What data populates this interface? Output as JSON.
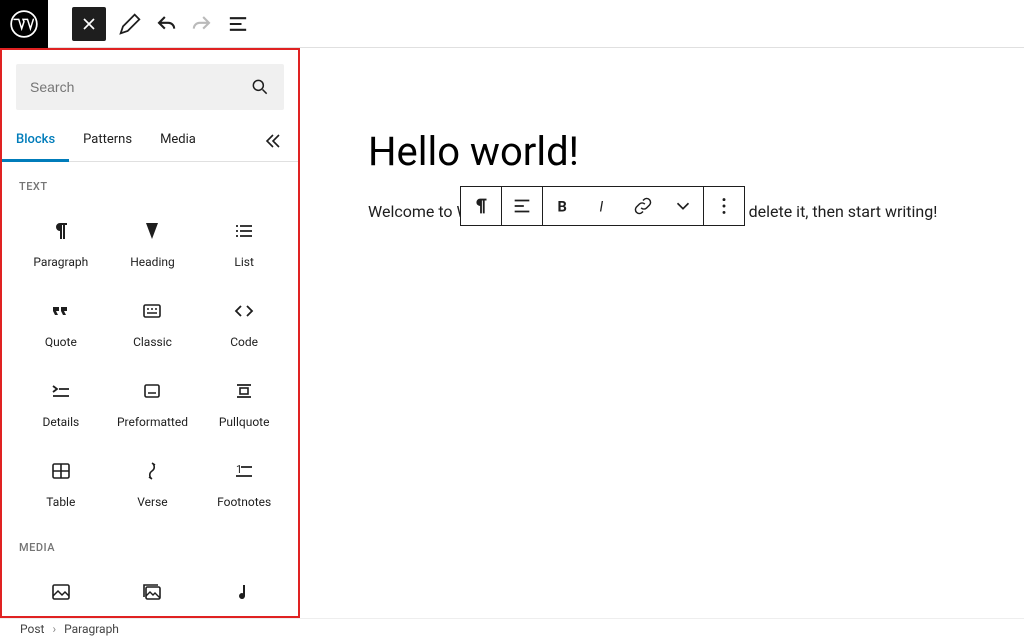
{
  "topbar": {
    "close_tooltip": "Close",
    "edit_tooltip": "Tools",
    "undo_tooltip": "Undo",
    "redo_tooltip": "Redo",
    "outline_tooltip": "Document Overview"
  },
  "inserter": {
    "search_placeholder": "Search",
    "tabs": {
      "blocks": "Blocks",
      "patterns": "Patterns",
      "media": "Media"
    },
    "section_text": "TEXT",
    "section_media": "MEDIA",
    "text_blocks": {
      "paragraph": "Paragraph",
      "heading": "Heading",
      "list": "List",
      "quote": "Quote",
      "classic": "Classic",
      "code": "Code",
      "details": "Details",
      "preformatted": "Preformatted",
      "pullquote": "Pullquote",
      "table": "Table",
      "verse": "Verse",
      "footnotes": "Footnotes"
    },
    "media_blocks": {
      "image": "Image",
      "gallery": "Gallery",
      "audio": "Audio"
    }
  },
  "editor": {
    "title": "Hello world!",
    "paragraph": "Welcome to WordPress. This is your first post. Edit or delete it, then start writing!"
  },
  "breadcrumb": {
    "post": "Post",
    "block": "Paragraph"
  }
}
